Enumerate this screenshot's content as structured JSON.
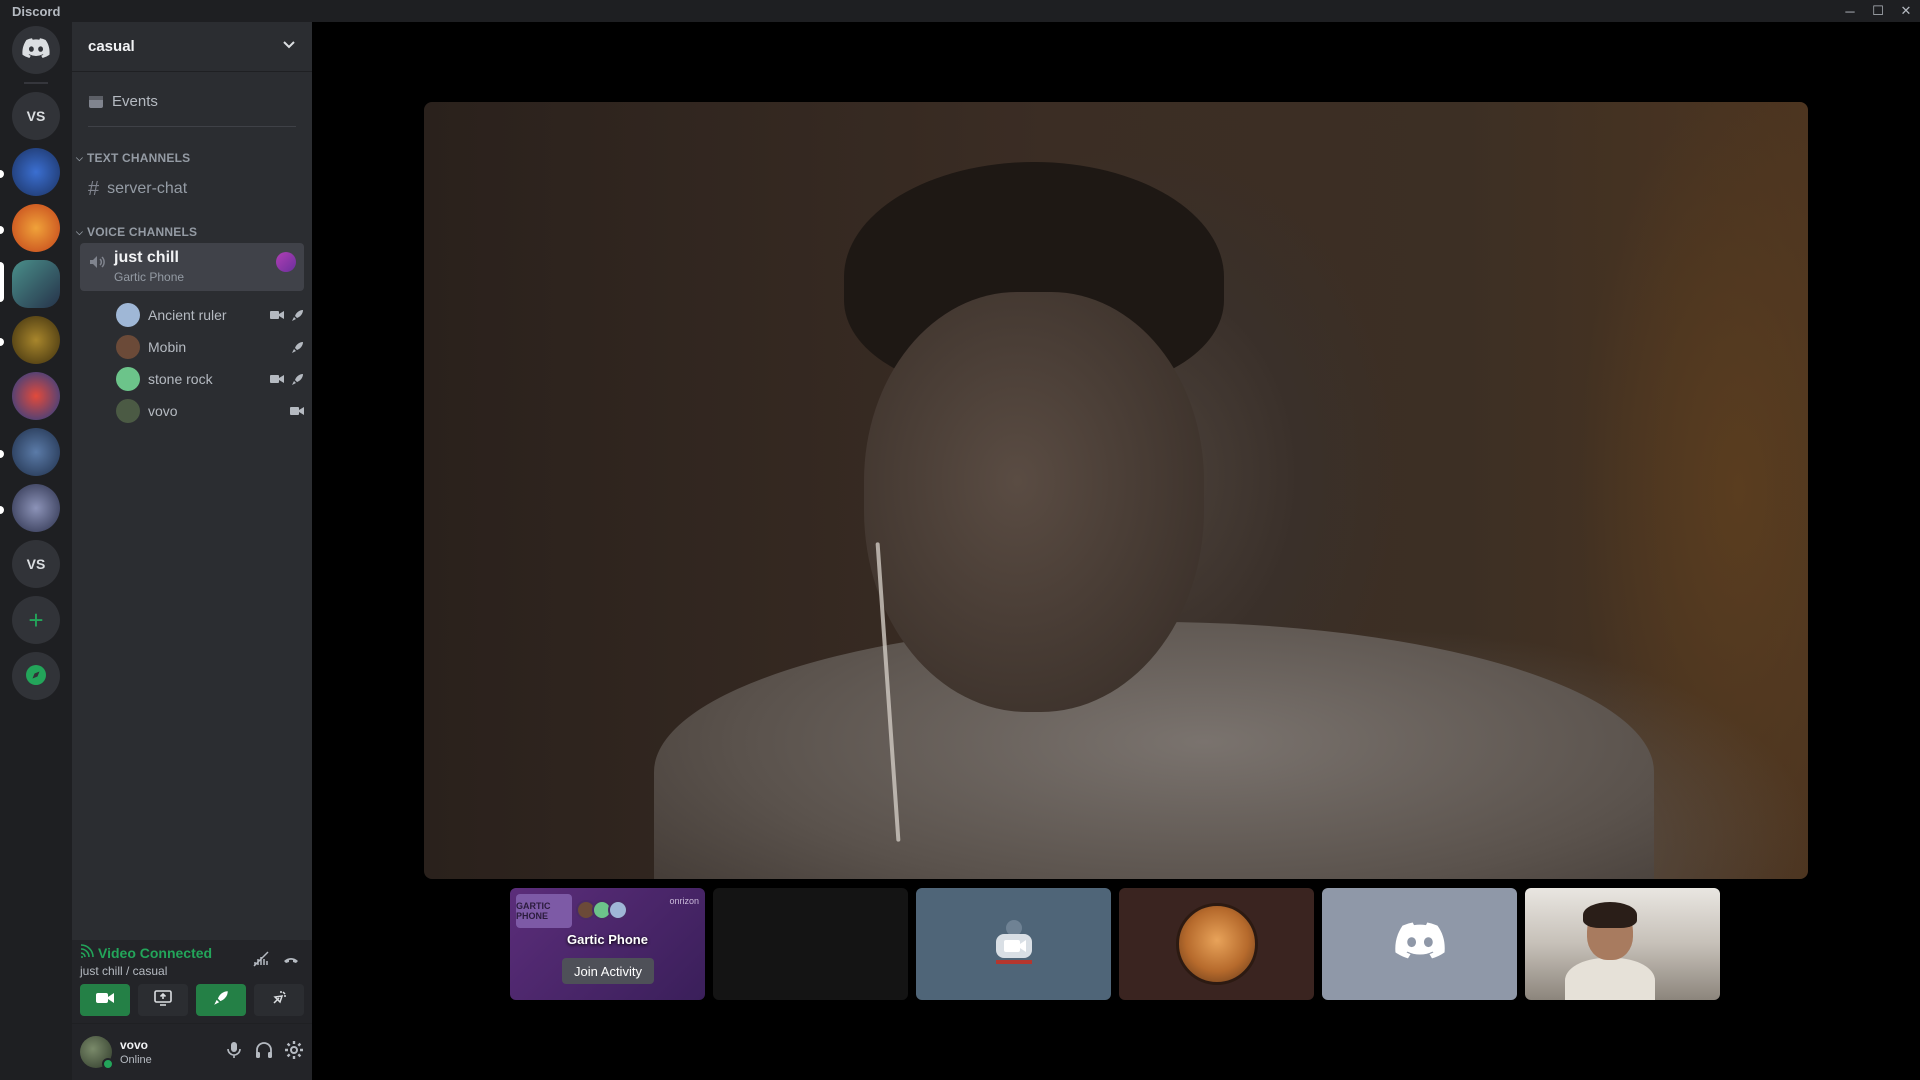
{
  "window": {
    "title": "Discord",
    "controls": [
      "─",
      "☐",
      "✕"
    ]
  },
  "rail": {
    "servers": [
      {
        "label": "VS"
      },
      {
        "label": ""
      },
      {
        "label": ""
      },
      {
        "label": ""
      },
      {
        "label": ""
      },
      {
        "label": ""
      },
      {
        "label": ""
      },
      {
        "label": ""
      },
      {
        "label": "VS"
      }
    ],
    "add_label": "+"
  },
  "guild": {
    "name": "casual",
    "events_label": "Events",
    "text_category": "TEXT CHANNELS",
    "text_channels": [
      {
        "name": "server-chat"
      }
    ],
    "voice_category": "VOICE CHANNELS",
    "voice_channel": {
      "name": "just chill",
      "activity": "Gartic Phone"
    },
    "members": [
      {
        "name": "Ancient ruler",
        "avatar_color": "#9fb7d6",
        "video": true,
        "activity": true
      },
      {
        "name": "Mobin",
        "avatar_color": "#6b4a38",
        "video": false,
        "activity": true
      },
      {
        "name": "stone rock",
        "avatar_color": "#6cc48a",
        "video": true,
        "activity": true
      },
      {
        "name": "vovo",
        "avatar_color": "#4b5a44",
        "video": true,
        "activity": false
      }
    ]
  },
  "voice_panel": {
    "status": "Video Connected",
    "location": "just chill / casual"
  },
  "user": {
    "name": "vovo",
    "status": "Online"
  },
  "stage": {
    "activity_tile": {
      "name": "Gartic Phone",
      "button": "Join Activity",
      "logo": "GARTIC PHONE",
      "brand": "onrizon"
    }
  },
  "colors": {
    "accent_green": "#23a55a",
    "button_green": "#248046",
    "sidebar": "#2b2d31",
    "rail": "#1e1f22"
  }
}
